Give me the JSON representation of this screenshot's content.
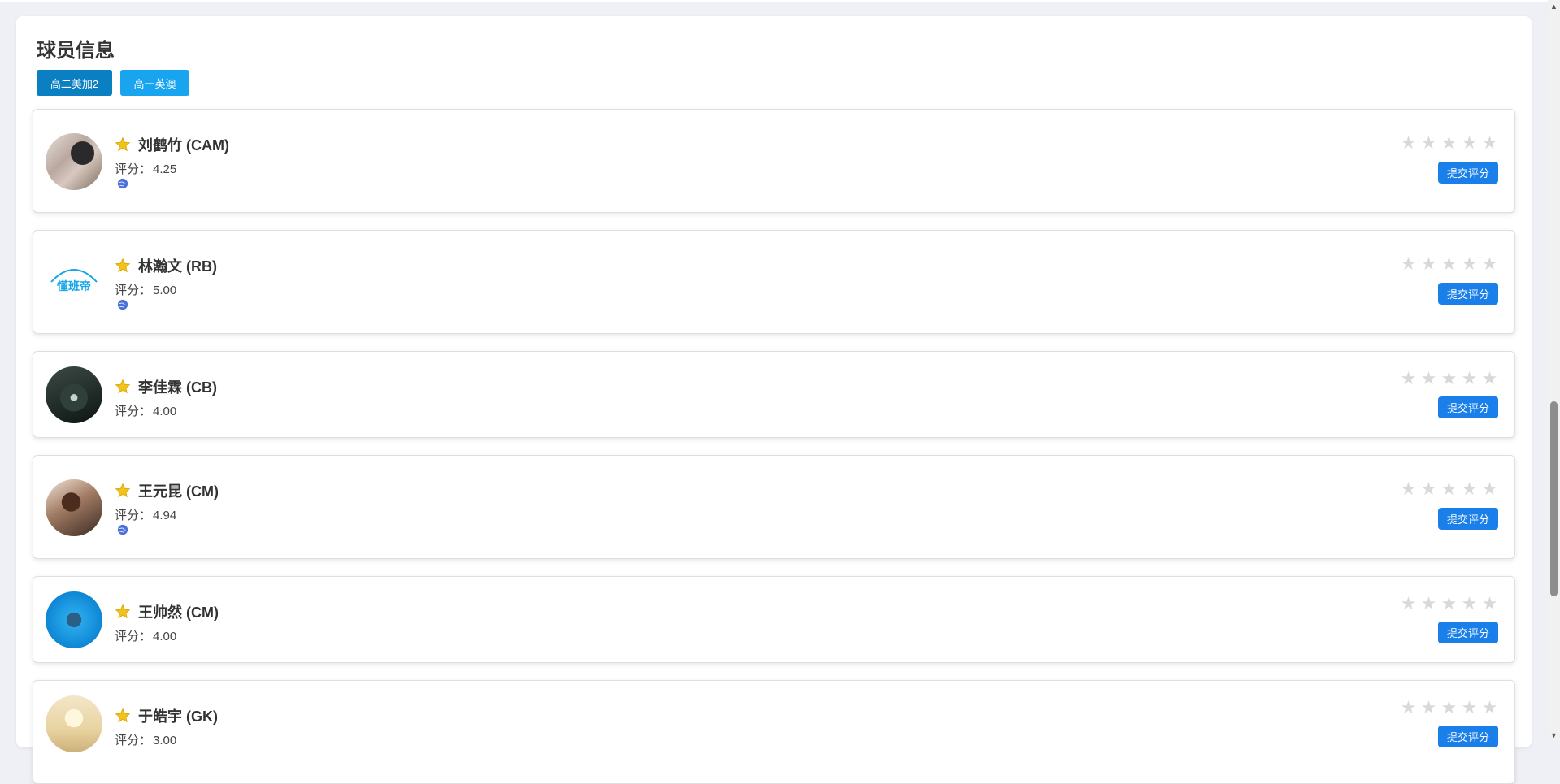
{
  "panel": {
    "title": "球员信息",
    "tabs": [
      {
        "label": "高二美加2"
      },
      {
        "label": "高一英澳"
      }
    ]
  },
  "score_label": "评分：",
  "submit_label": "提交评分",
  "rating_star_glyph": "★",
  "players": [
    {
      "name": "刘鹤竹 (CAM)",
      "score": "4.25",
      "has_globe": true,
      "avatar": "photo-portrait"
    },
    {
      "name": "林瀚文 (RB)",
      "score": "5.00",
      "has_globe": true,
      "avatar": "logo-dongbandi",
      "avatar_text": "懂班帝"
    },
    {
      "name": "李佳霖 (CB)",
      "score": "4.00",
      "has_globe": false,
      "avatar": "photo-anime"
    },
    {
      "name": "王元昆 (CM)",
      "score": "4.94",
      "has_globe": true,
      "avatar": "photo-portrait"
    },
    {
      "name": "王帅然 (CM)",
      "score": "4.00",
      "has_globe": false,
      "avatar": "photo-underwater"
    },
    {
      "name": "于皓宇 (GK)",
      "score": "3.00",
      "has_globe": false,
      "avatar": "photo-painting"
    }
  ],
  "colors": {
    "primary_tab": "#0a7fc2",
    "secondary_tab": "#18a4ee",
    "submit_button": "#1a7fe8",
    "favorite_star": "#f2c31b",
    "rating_star_empty": "#d9d9d9"
  }
}
